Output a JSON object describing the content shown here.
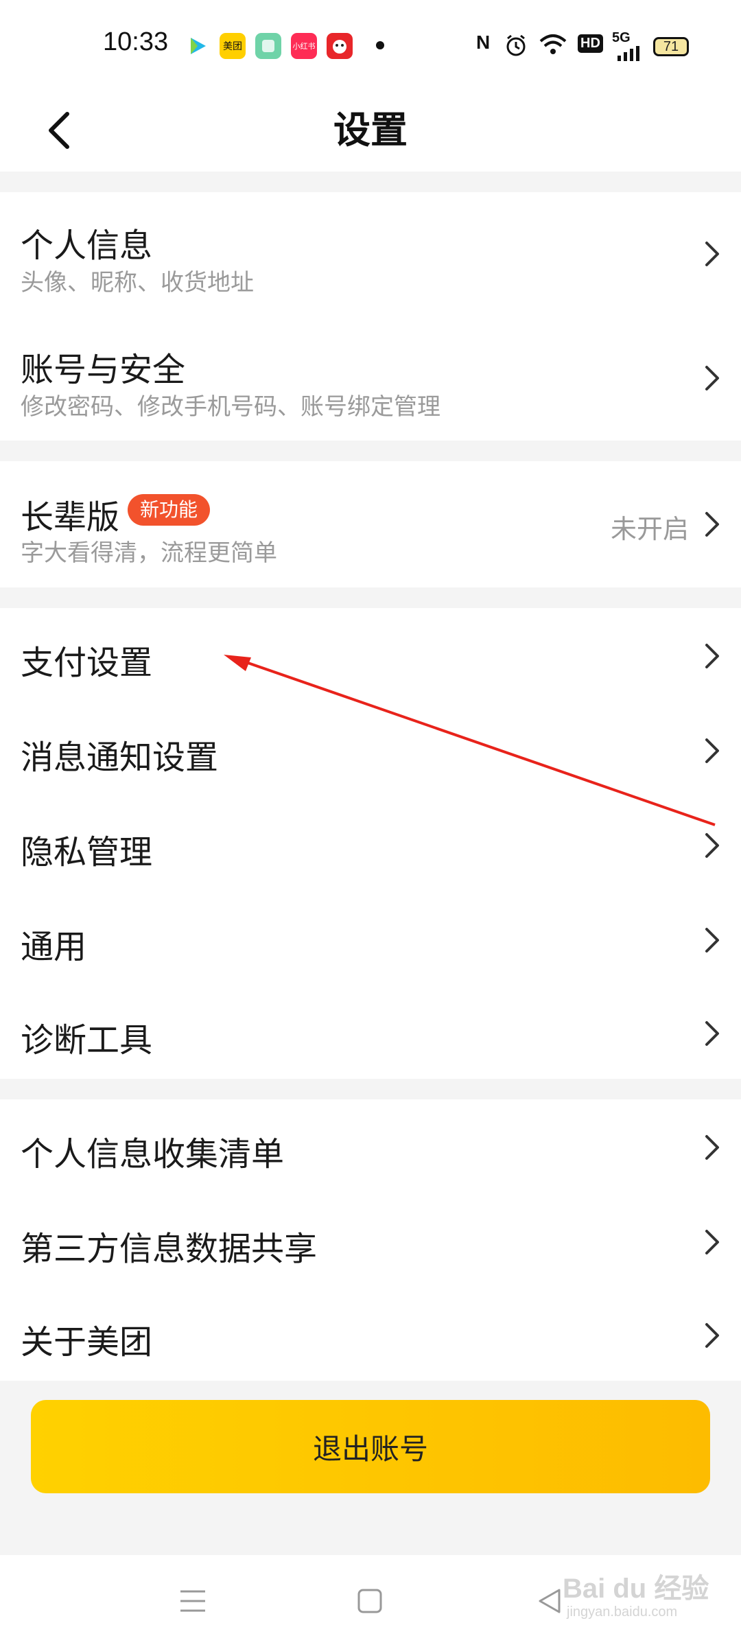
{
  "status_bar": {
    "time": "10:33",
    "app_icons": [
      "video-app-icon",
      "meituan-app-icon",
      "gallery-app-icon",
      "xiaohongshu-app-icon",
      "jd-app-icon"
    ],
    "meituan_label": "美团",
    "xiaohongshu_label": "小红书",
    "nfc": "N",
    "hd": "HD",
    "network": "5G",
    "battery": "71"
  },
  "header": {
    "title": "设置"
  },
  "groups": [
    [
      {
        "title": "个人信息",
        "subtitle": "头像、昵称、收货地址"
      },
      {
        "title": "账号与安全",
        "subtitle": "修改密码、修改手机号码、账号绑定管理"
      }
    ],
    [
      {
        "title": "长辈版",
        "badge": "新功能",
        "subtitle": "字大看得清，流程更简单",
        "value": "未开启"
      }
    ],
    [
      {
        "title": "支付设置"
      },
      {
        "title": "消息通知设置"
      },
      {
        "title": "隐私管理"
      },
      {
        "title": "通用"
      },
      {
        "title": "诊断工具"
      }
    ],
    [
      {
        "title": "个人信息收集清单"
      },
      {
        "title": "第三方信息数据共享"
      },
      {
        "title": "关于美团"
      }
    ]
  ],
  "logout_label": "退出账号",
  "watermark": {
    "brand": "Bai du 经验",
    "url": "jingyan.baidu.com"
  },
  "colors": {
    "accent": "#FFCC00",
    "badge": "#F2522C",
    "annotation_arrow": "#E8231B"
  }
}
